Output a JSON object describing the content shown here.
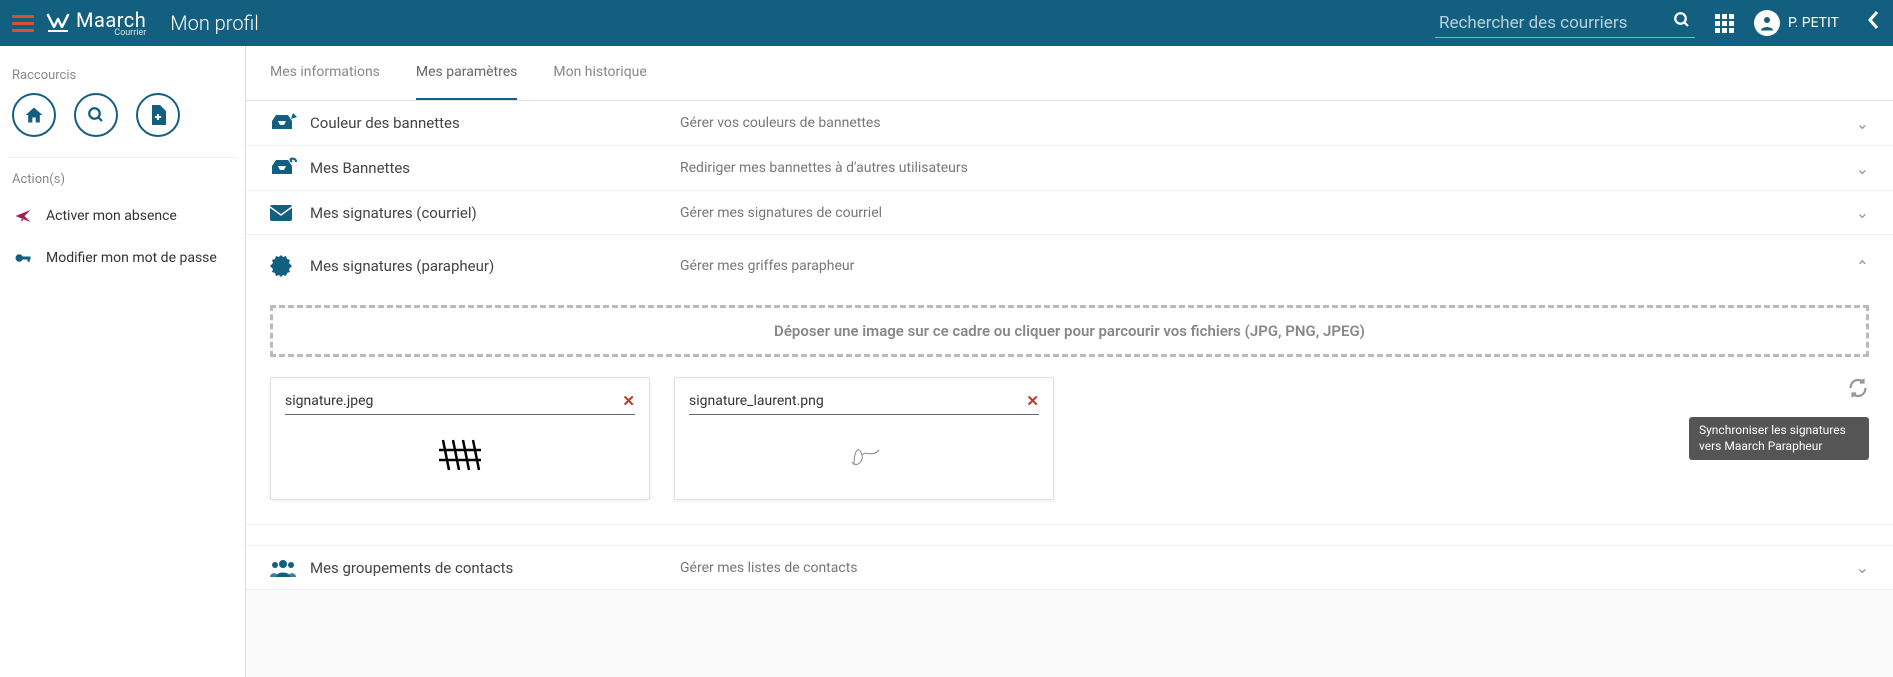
{
  "header": {
    "logo_text": "Maarch",
    "logo_sub": "Courrier",
    "page_title": "Mon profil",
    "search_placeholder": "Rechercher des courriers",
    "user_name": "P. PETIT"
  },
  "sidebar": {
    "shortcuts_title": "Raccourcis",
    "actions_title": "Action(s)",
    "actions": [
      {
        "label": "Activer mon absence"
      },
      {
        "label": "Modifier mon mot de passe"
      }
    ]
  },
  "tabs": [
    {
      "label": "Mes informations",
      "active": false
    },
    {
      "label": "Mes paramètres",
      "active": true
    },
    {
      "label": "Mon historique",
      "active": false
    }
  ],
  "settings": {
    "bannettes_color": {
      "title": "Couleur des bannettes",
      "desc": "Gérer vos couleurs de bannettes"
    },
    "bannettes": {
      "title": "Mes Bannettes",
      "desc": "Rediriger mes bannettes à d'autres utilisateurs"
    },
    "sig_email": {
      "title": "Mes signatures (courriel)",
      "desc": "Gérer mes signatures de courriel"
    },
    "sig_parapheur": {
      "title": "Mes signatures (parapheur)",
      "desc": "Gérer mes griffes parapheur"
    },
    "contacts": {
      "title": "Mes groupements de contacts",
      "desc": "Gérer mes listes de contacts"
    }
  },
  "dropzone_text": "Déposer une image sur ce cadre ou cliquer pour parcourir vos fichiers (JPG, PNG, JPEG)",
  "signatures": [
    {
      "filename": "signature.jpeg"
    },
    {
      "filename": "signature_laurent.png"
    }
  ],
  "sync_tooltip": "Synchroniser les signatures vers Maarch Parapheur"
}
